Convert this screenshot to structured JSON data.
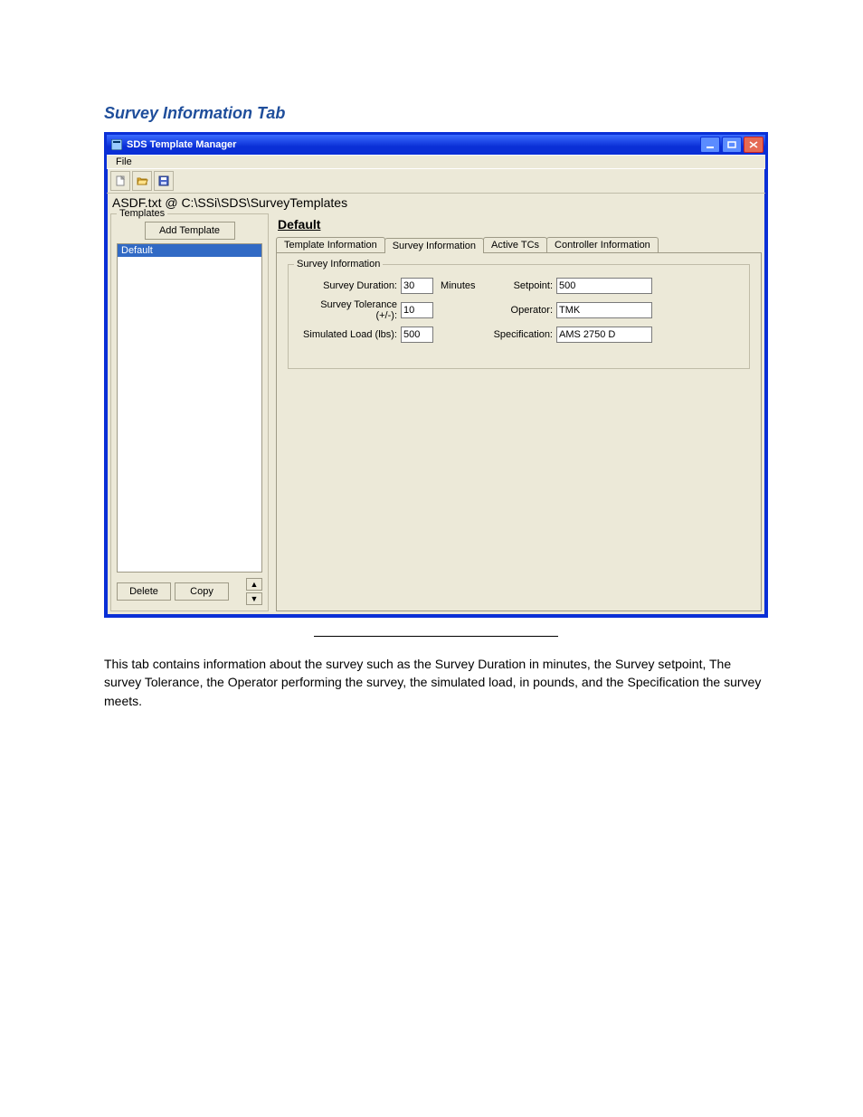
{
  "section_heading": "Survey Information Tab",
  "window": {
    "title": "SDS Template Manager",
    "menu": {
      "file": "File"
    },
    "path": "ASDF.txt @ C:\\SSi\\SDS\\SurveyTemplates",
    "templates": {
      "legend": "Templates",
      "add_label": "Add Template",
      "items": [
        "Default"
      ],
      "delete_label": "Delete",
      "copy_label": "Copy"
    },
    "main": {
      "current_name": "Default",
      "tabs": {
        "template_info": "Template Information",
        "survey_info": "Survey Information",
        "active_tcs": "Active TCs",
        "controller_info": "Controller Information"
      },
      "fieldset_legend": "Survey Information",
      "labels": {
        "duration": "Survey Duration:",
        "minutes": "Minutes",
        "setpoint": "Setpoint:",
        "tolerance": "Survey Tolerance  (+/-):",
        "operator": "Operator:",
        "simload": "Simulated Load (lbs):",
        "spec": "Specification:"
      },
      "values": {
        "duration": "30",
        "setpoint": "500",
        "tolerance": "10",
        "operator": "TMK",
        "simload": "500",
        "spec": "AMS 2750 D"
      }
    }
  },
  "body_text": "This tab contains information about the survey such as the Survey Duration in minutes, the Survey setpoint, The survey Tolerance, the Operator performing the survey, the simulated load, in pounds, and the Specification the survey meets."
}
